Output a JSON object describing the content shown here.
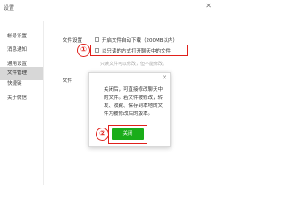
{
  "window": {
    "title": "设置",
    "close_glyph": "✕"
  },
  "sidebar": {
    "items": [
      {
        "label": "帐号设置",
        "active": false
      },
      {
        "label": "消息通知",
        "active": false
      },
      {
        "label": "通用设置",
        "active": false
      },
      {
        "label": "文件管理",
        "active": true
      },
      {
        "label": "快捷键",
        "active": false
      },
      {
        "label": "关于微信",
        "active": false
      }
    ]
  },
  "file_settings": {
    "section_label": "文件设置",
    "auto_download_label": "开启文件自动下载（200MB以内）",
    "readonly_open_label": "以只读的方式打开聊天中的文件",
    "hint_text": "只读文件可以修改，但不能修改。",
    "side_label": "文件"
  },
  "dialog": {
    "close_glyph": "✕",
    "body_text": "关闭后，可直接修改聊天中的文件。若文件被修改，转发、收藏、保存到本地的文件为被修改后的版本。",
    "confirm_label": "关闭"
  },
  "annotations": {
    "marker_1": "①",
    "marker_2": "②",
    "color": "#e0201b"
  },
  "colors": {
    "sidebar_active_bg": "#d7d7d7",
    "primary_button": "#1aad19",
    "annotation_red": "#e0201b"
  }
}
